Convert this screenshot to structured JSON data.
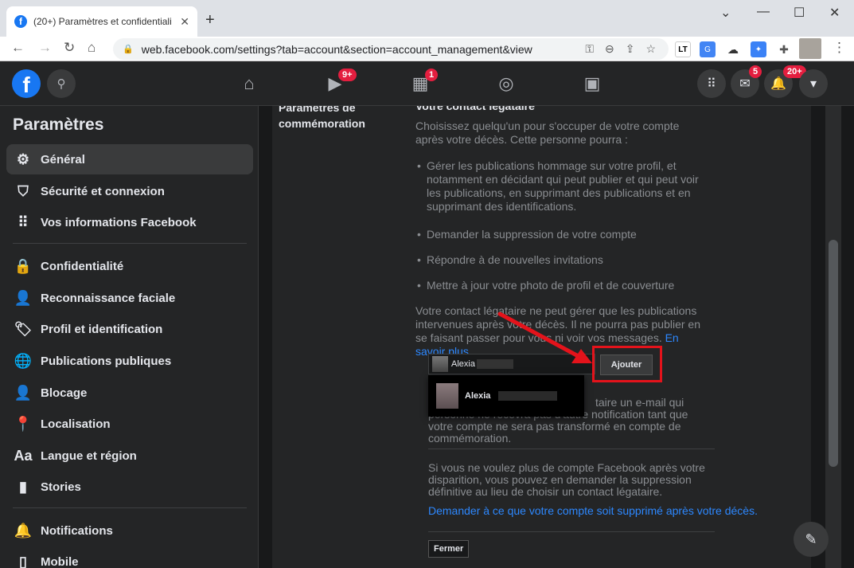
{
  "browser": {
    "tab_title": "(20+) Paramètres et confidentiali",
    "url": "web.facebook.com/settings?tab=account&section=account_management&view"
  },
  "header": {
    "watch_badge": "9+",
    "marketplace_badge": "1",
    "messenger_badge": "5",
    "notifications_badge": "20+"
  },
  "sidebar": {
    "title": "Paramètres",
    "items": [
      {
        "label": "Général",
        "icon": "gear-icon"
      },
      {
        "label": "Sécurité et connexion",
        "icon": "shield-icon"
      },
      {
        "label": "Vos informations Facebook",
        "icon": "grid-icon"
      },
      {
        "label": "Confidentialité",
        "icon": "lock-icon"
      },
      {
        "label": "Reconnaissance faciale",
        "icon": "face-icon"
      },
      {
        "label": "Profil et identification",
        "icon": "tag-icon"
      },
      {
        "label": "Publications publiques",
        "icon": "globe-icon"
      },
      {
        "label": "Blocage",
        "icon": "block-user-icon"
      },
      {
        "label": "Localisation",
        "icon": "location-pin-icon"
      },
      {
        "label": "Langue et région",
        "icon": "language-icon"
      },
      {
        "label": "Stories",
        "icon": "stories-icon"
      },
      {
        "label": "Notifications",
        "icon": "bell-icon"
      },
      {
        "label": "Mobile",
        "icon": "mobile-icon"
      }
    ]
  },
  "main": {
    "left_title": "Paramètres de commémoration",
    "heading": "Votre contact légataire",
    "intro": "Choisissez quelqu'un pour s'occuper de votre compte après votre décès. Cette personne pourra :",
    "bullets": [
      "Gérer les publications hommage sur votre profil, et notamment en décidant qui peut publier et qui peut voir les publications, en supprimant des publications et en supprimant des identifications.",
      "Demander la suppression de votre compte",
      "Répondre à de nouvelles invitations",
      "Mettre à jour votre photo de profil et de couverture"
    ],
    "limit_text": "Votre contact légataire ne peut gérer que les publications intervenues après votre décès. Il ne pourra pas publier en se faisant passer pour vous ni voir vos messages.",
    "learn_more": "En savoir plus",
    "field_value": "Alexia",
    "add_button": "Ajouter",
    "suggestion_name": "Alexia",
    "notify_text": "taire un e-mail qui personne ne recevra pas d'autre notification tant que votre compte ne sera pas transformé en compte de commémoration.",
    "delete_text": "Si vous ne voulez plus de compte Facebook après votre disparition, vous pouvez en demander la suppression définitive au lieu de choisir un contact légataire.",
    "delete_link": "Demander à ce que votre compte soit supprimé après votre décès.",
    "close_button": "Fermer"
  },
  "colors": {
    "accent": "#1877f2",
    "link": "#2d88ff",
    "highlight_red": "#e4131b"
  }
}
